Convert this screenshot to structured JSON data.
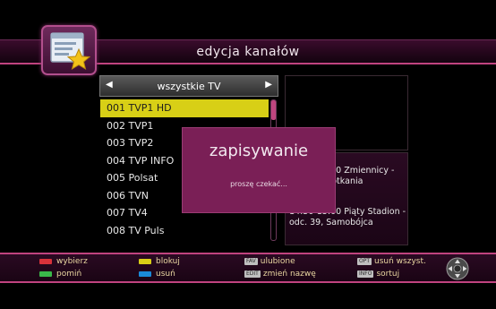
{
  "header": {
    "title": "edycja kanałów",
    "app_icon": "channel-edit-star-icon"
  },
  "list": {
    "selector_label": "wszystkie TV",
    "channels": [
      "001 TVP1 HD",
      "002 TVP1",
      "003 TVP2",
      "004 TVP INFO",
      "005 Polsat",
      "006 TVN",
      "007 TV4",
      "008 TV Puls"
    ],
    "selected_index": 0
  },
  "epg": {
    "event1": "13:00-14:30  Zmiennicy - odc. 3, Spotkania",
    "event2": "14:30-15:00  Piąty Stadion - odc. 39, Samobójca"
  },
  "dialog": {
    "title": "zapisywanie",
    "message": "proszę czekać..."
  },
  "footer": {
    "select": "wybierz",
    "lock": "blokuj",
    "skip": "pomiń",
    "delete": "usuń",
    "fav_tag": "FAV",
    "fav": "ulubione",
    "edit_tag": "EDIT",
    "rename": "zmień nazwę",
    "opt_tag": "OPT",
    "delete_all": "usuń wszyst.",
    "info_tag": "INFO",
    "sort": "sortuj"
  },
  "colors": {
    "accent": "#c0437f",
    "selected_row": "#d8cf16",
    "dialog_bg": "#7a1f56",
    "red_key": "#d8323a",
    "yellow_key": "#d8cf16",
    "green_key": "#3ab84a",
    "blue_key": "#1a8ad8"
  }
}
